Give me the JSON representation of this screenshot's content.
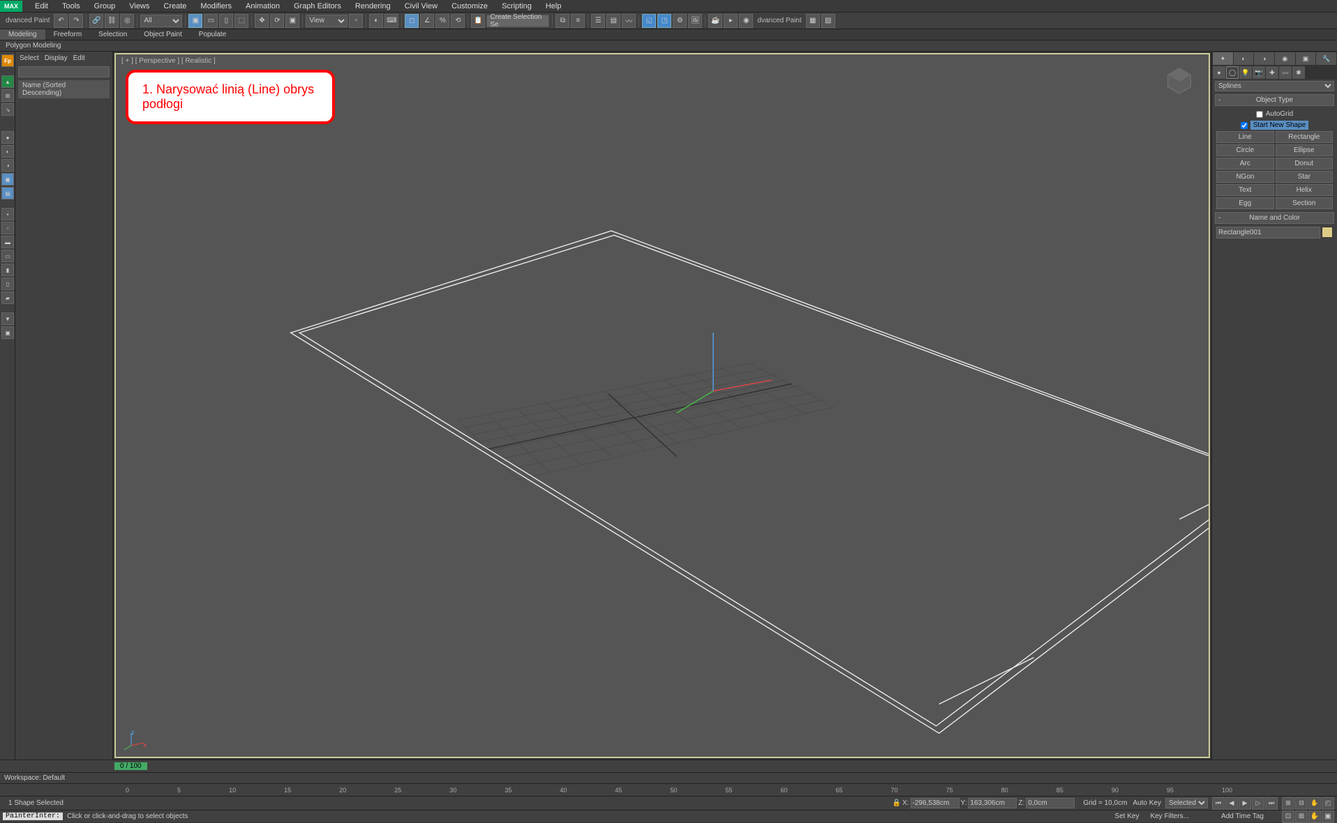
{
  "menu": {
    "logo": "MAX",
    "items": [
      "Edit",
      "Tools",
      "Group",
      "Views",
      "Create",
      "Modifiers",
      "Animation",
      "Graph Editors",
      "Rendering",
      "Civil View",
      "Customize",
      "Scripting",
      "Help"
    ]
  },
  "toolbar": {
    "left_label": "dvanced Paint",
    "all": "All",
    "view": "View",
    "create_sel_lbl": "Create Selection Se",
    "right_label": "dvanced Paint"
  },
  "ribbon": {
    "tabs": [
      "Modeling",
      "Freeform",
      "Selection",
      "Object Paint",
      "Populate"
    ],
    "active": 0,
    "sub": "Polygon Modeling"
  },
  "scene": {
    "tabs": [
      "Select",
      "Display",
      "Edit"
    ],
    "header": "Name (Sorted Descending)"
  },
  "viewport": {
    "label": "[ + ] [ Perspective ] [ Realistic ]"
  },
  "annotation": {
    "text": "1. Narysować linią (Line) obrys podłogi"
  },
  "cmd": {
    "category": "Splines",
    "objtype_head": "Object Type",
    "autogrid": "AutoGrid",
    "startshape": "Start New Shape",
    "buttons": [
      "Line",
      "Rectangle",
      "Circle",
      "Ellipse",
      "Arc",
      "Donut",
      "NGon",
      "Star",
      "Text",
      "Helix",
      "Egg",
      "Section"
    ],
    "namecolor_head": "Name and Color",
    "objname": "Rectangle001"
  },
  "timeline": {
    "frame": "0 / 100"
  },
  "workspace": "Workspace: Default",
  "ruler": {
    "ticks": [
      "0",
      "5",
      "10",
      "15",
      "20",
      "25",
      "30",
      "35",
      "40",
      "45",
      "50",
      "55",
      "60",
      "65",
      "70",
      "75",
      "80",
      "85",
      "90",
      "95",
      "100"
    ]
  },
  "status": {
    "sel": "1 Shape Selected",
    "xl": "X:",
    "x": "-296,538cm",
    "yl": "Y:",
    "y": "163,306cm",
    "zl": "Z:",
    "z": "0,0cm",
    "grid": "Grid = 10,0cm",
    "autokey": "Auto Key",
    "selected": "Selected",
    "setkey": "Set Key",
    "keyfilters": "Key Filters..."
  },
  "prompt": {
    "field": "PainterInter:",
    "msg": "Click or click-and-drag to select objects",
    "addtime": "Add Time Tag"
  }
}
